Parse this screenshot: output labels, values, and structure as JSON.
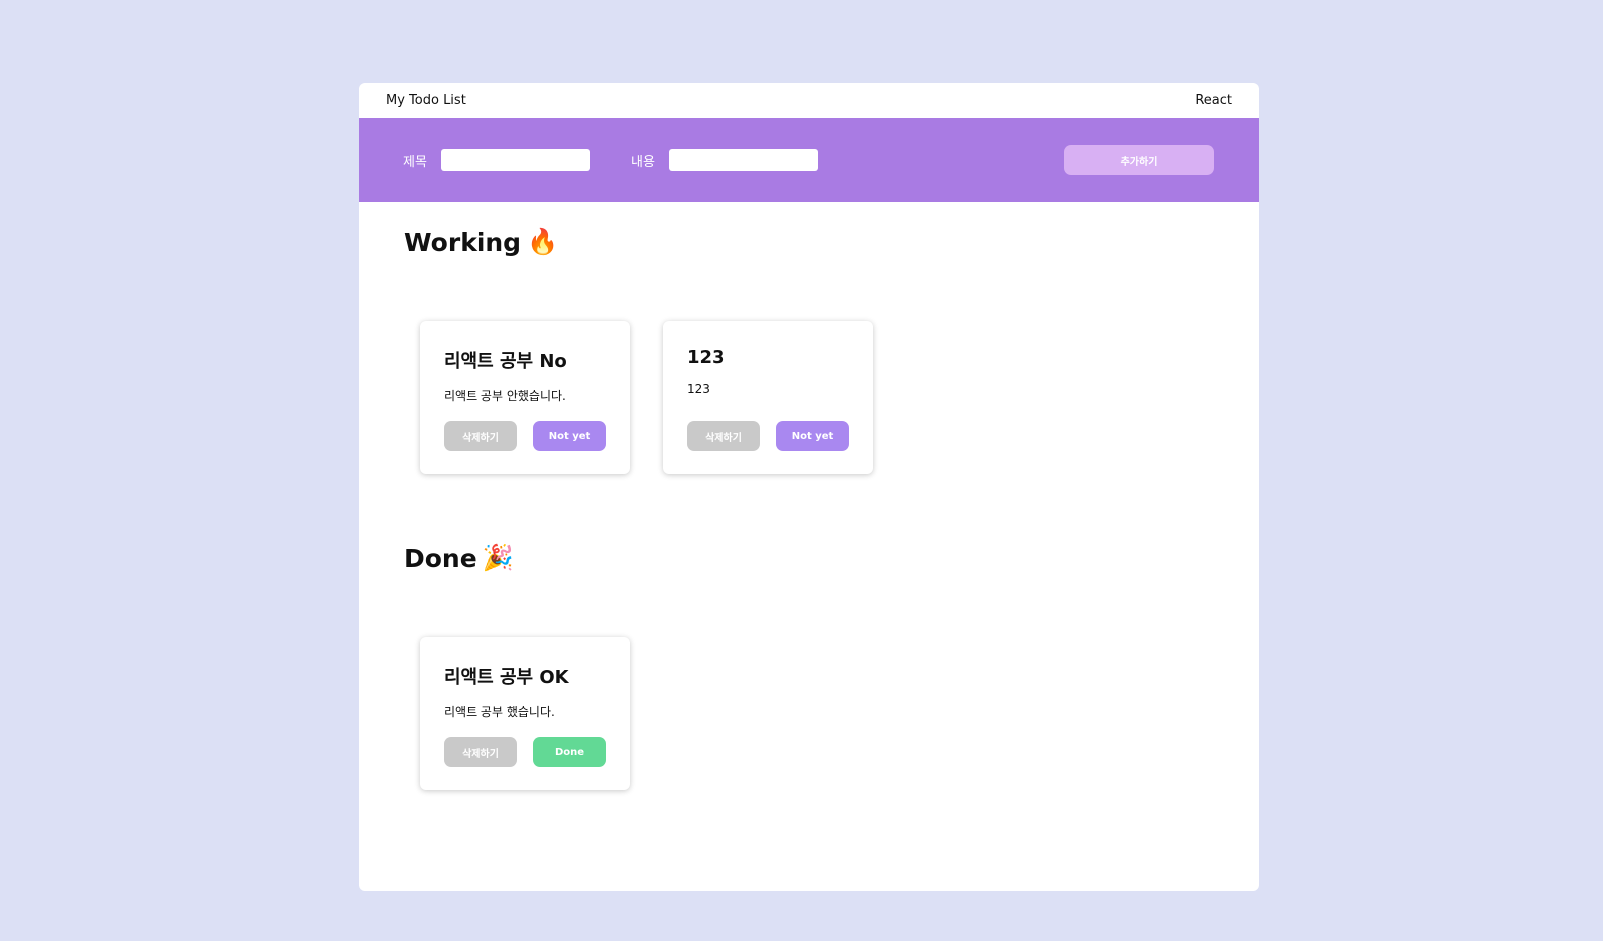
{
  "header": {
    "title": "My Todo List",
    "right_label": "React"
  },
  "form": {
    "title_label": "제목",
    "title_value": "",
    "content_label": "내용",
    "content_value": "",
    "add_button": "추가하기"
  },
  "working": {
    "heading": "Working",
    "emoji": "🔥",
    "cards": [
      {
        "title": "리액트 공부 No",
        "body": "리액트 공부 안했습니다.",
        "delete_label": "삭제하기",
        "toggle_label": "Not yet"
      },
      {
        "title": "123",
        "body": "123",
        "delete_label": "삭제하기",
        "toggle_label": "Not yet"
      }
    ]
  },
  "done": {
    "heading": "Done",
    "emoji": "🎉",
    "cards": [
      {
        "title": "리액트 공부 OK",
        "body": "리액트 공부 했습니다.",
        "delete_label": "삭제하기",
        "toggle_label": "Done"
      }
    ]
  },
  "colors": {
    "background": "#dce0f5",
    "accent": "#a97be3",
    "add_button": "#d8b0f3",
    "not_yet_button": "#a988f0",
    "done_button": "#62d995",
    "delete_button": "#c9c9c9"
  }
}
